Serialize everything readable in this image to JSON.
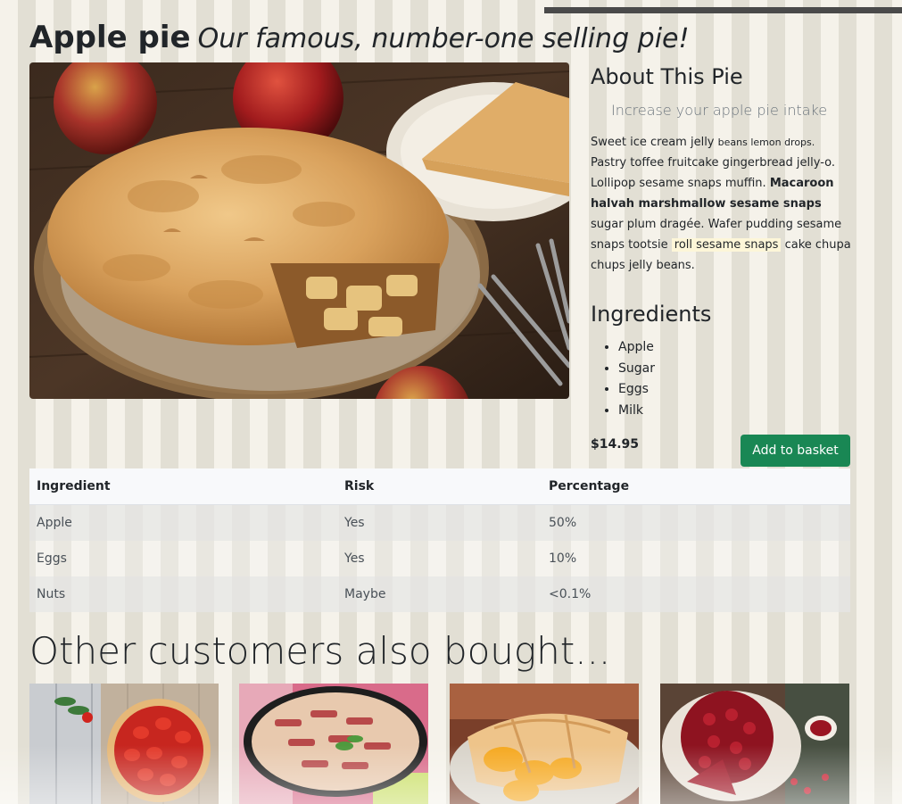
{
  "product": {
    "name": "Apple pie",
    "tagline": "Our famous, number-one selling pie!",
    "price": "$14.95",
    "add_to_basket_label": "Add to basket"
  },
  "about": {
    "title": "About This Pie",
    "subtitle": "Increase your apple pie intake",
    "desc_1": "Sweet ice cream jelly",
    "desc_2": "beans lemon drops.",
    "desc_3": "Pastry toffee fruitcake gingerbread jelly-o. Lollipop sesame snaps muffin.",
    "desc_bold": "Macaroon halvah marshmallow sesame snaps",
    "desc_4": "sugar plum dragée. Wafer pudding sesame snaps tootsie",
    "desc_highlight": "roll sesame snaps",
    "desc_5": "cake chupa  chups jelly beans."
  },
  "ingredients": {
    "title": "Ingredients",
    "items": [
      "Apple",
      "Sugar",
      "Eggs",
      "Milk"
    ]
  },
  "risk_table": {
    "headers": [
      "Ingredient",
      "Risk",
      "Percentage"
    ],
    "rows": [
      [
        "Apple",
        "Yes",
        "50%"
      ],
      [
        "Eggs",
        "Yes",
        "10%"
      ],
      [
        "Nuts",
        "Maybe",
        "<0.1%"
      ]
    ]
  },
  "also_bought": {
    "title": "Other customers also bought...",
    "items": [
      {
        "icon": "strawberry-tart-image"
      },
      {
        "icon": "rhubarb-pie-image"
      },
      {
        "icon": "peach-pie-image"
      },
      {
        "icon": "cherry-pie-image"
      }
    ]
  }
}
